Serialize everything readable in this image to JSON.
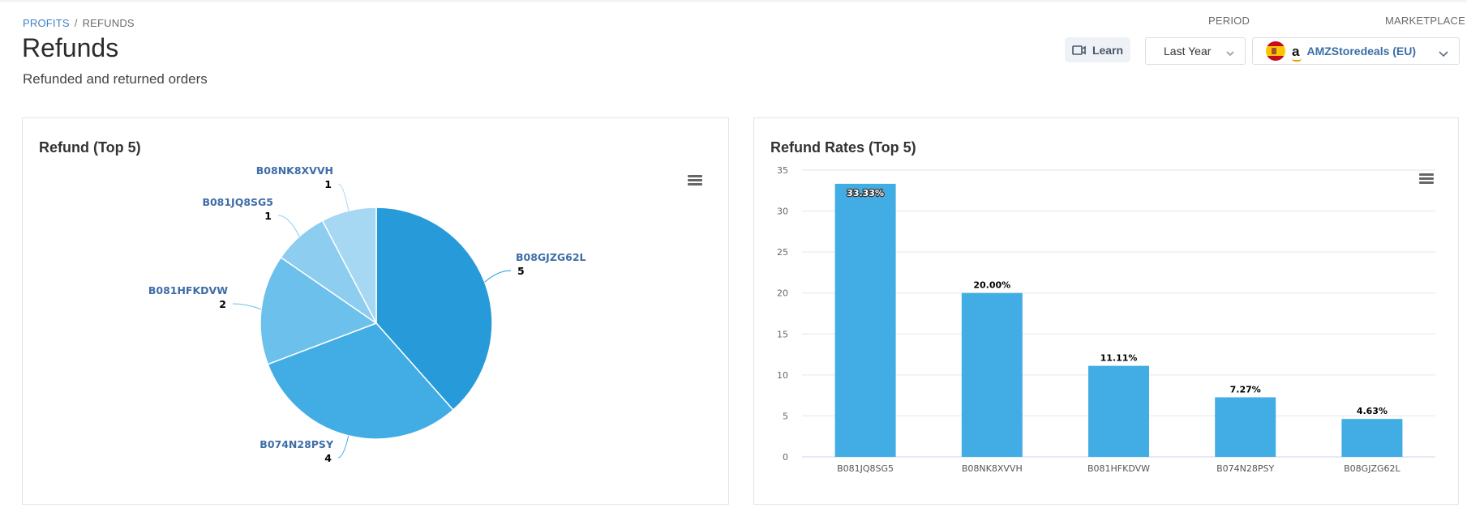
{
  "breadcrumb": {
    "parent": "PROFITS",
    "separator": "/",
    "current": "REFUNDS"
  },
  "page": {
    "title": "Refunds",
    "subtitle": "Refunded and returned orders"
  },
  "toolbar": {
    "learn_label": "Learn",
    "period_label": "PERIOD",
    "period_value": "Last Year",
    "marketplace_label": "MARKETPLACE",
    "marketplace_value": "AMZStoredeals (EU)",
    "marketplace_flag": "spain-flag-icon",
    "marketplace_logo": "amazon-logo-icon"
  },
  "colors": {
    "accent": "#3b82c4",
    "bar": "#42ade4",
    "pie": [
      "#279bd9",
      "#42ade4",
      "#6cc0ec",
      "#8ccdf0",
      "#a6d8f3"
    ]
  },
  "chart_data": [
    {
      "type": "pie",
      "title": "Refund (Top 5)",
      "categories": [
        "B08GJZG62L",
        "B074N28PSY",
        "B081HFKDVW",
        "B081JQ8SG5",
        "B08NK8XVVH"
      ],
      "values": [
        5,
        4,
        2,
        1,
        1
      ],
      "data_labels": true,
      "legend": "none"
    },
    {
      "type": "bar",
      "title": "Refund Rates (Top 5)",
      "categories": [
        "B081JQ8SG5",
        "B08NK8XVVH",
        "B081HFKDVW",
        "B074N28PSY",
        "B08GJZG62L"
      ],
      "values": [
        33.33,
        20.0,
        11.11,
        7.27,
        4.63
      ],
      "data_labels": [
        "33.33%",
        "20.00%",
        "11.11%",
        "7.27%",
        "4.63%"
      ],
      "xlabel": "",
      "ylabel": "",
      "ylim": [
        0,
        35
      ],
      "yticks": [
        0,
        5,
        10,
        15,
        20,
        25,
        30,
        35
      ],
      "grid": true,
      "legend": "none"
    }
  ]
}
